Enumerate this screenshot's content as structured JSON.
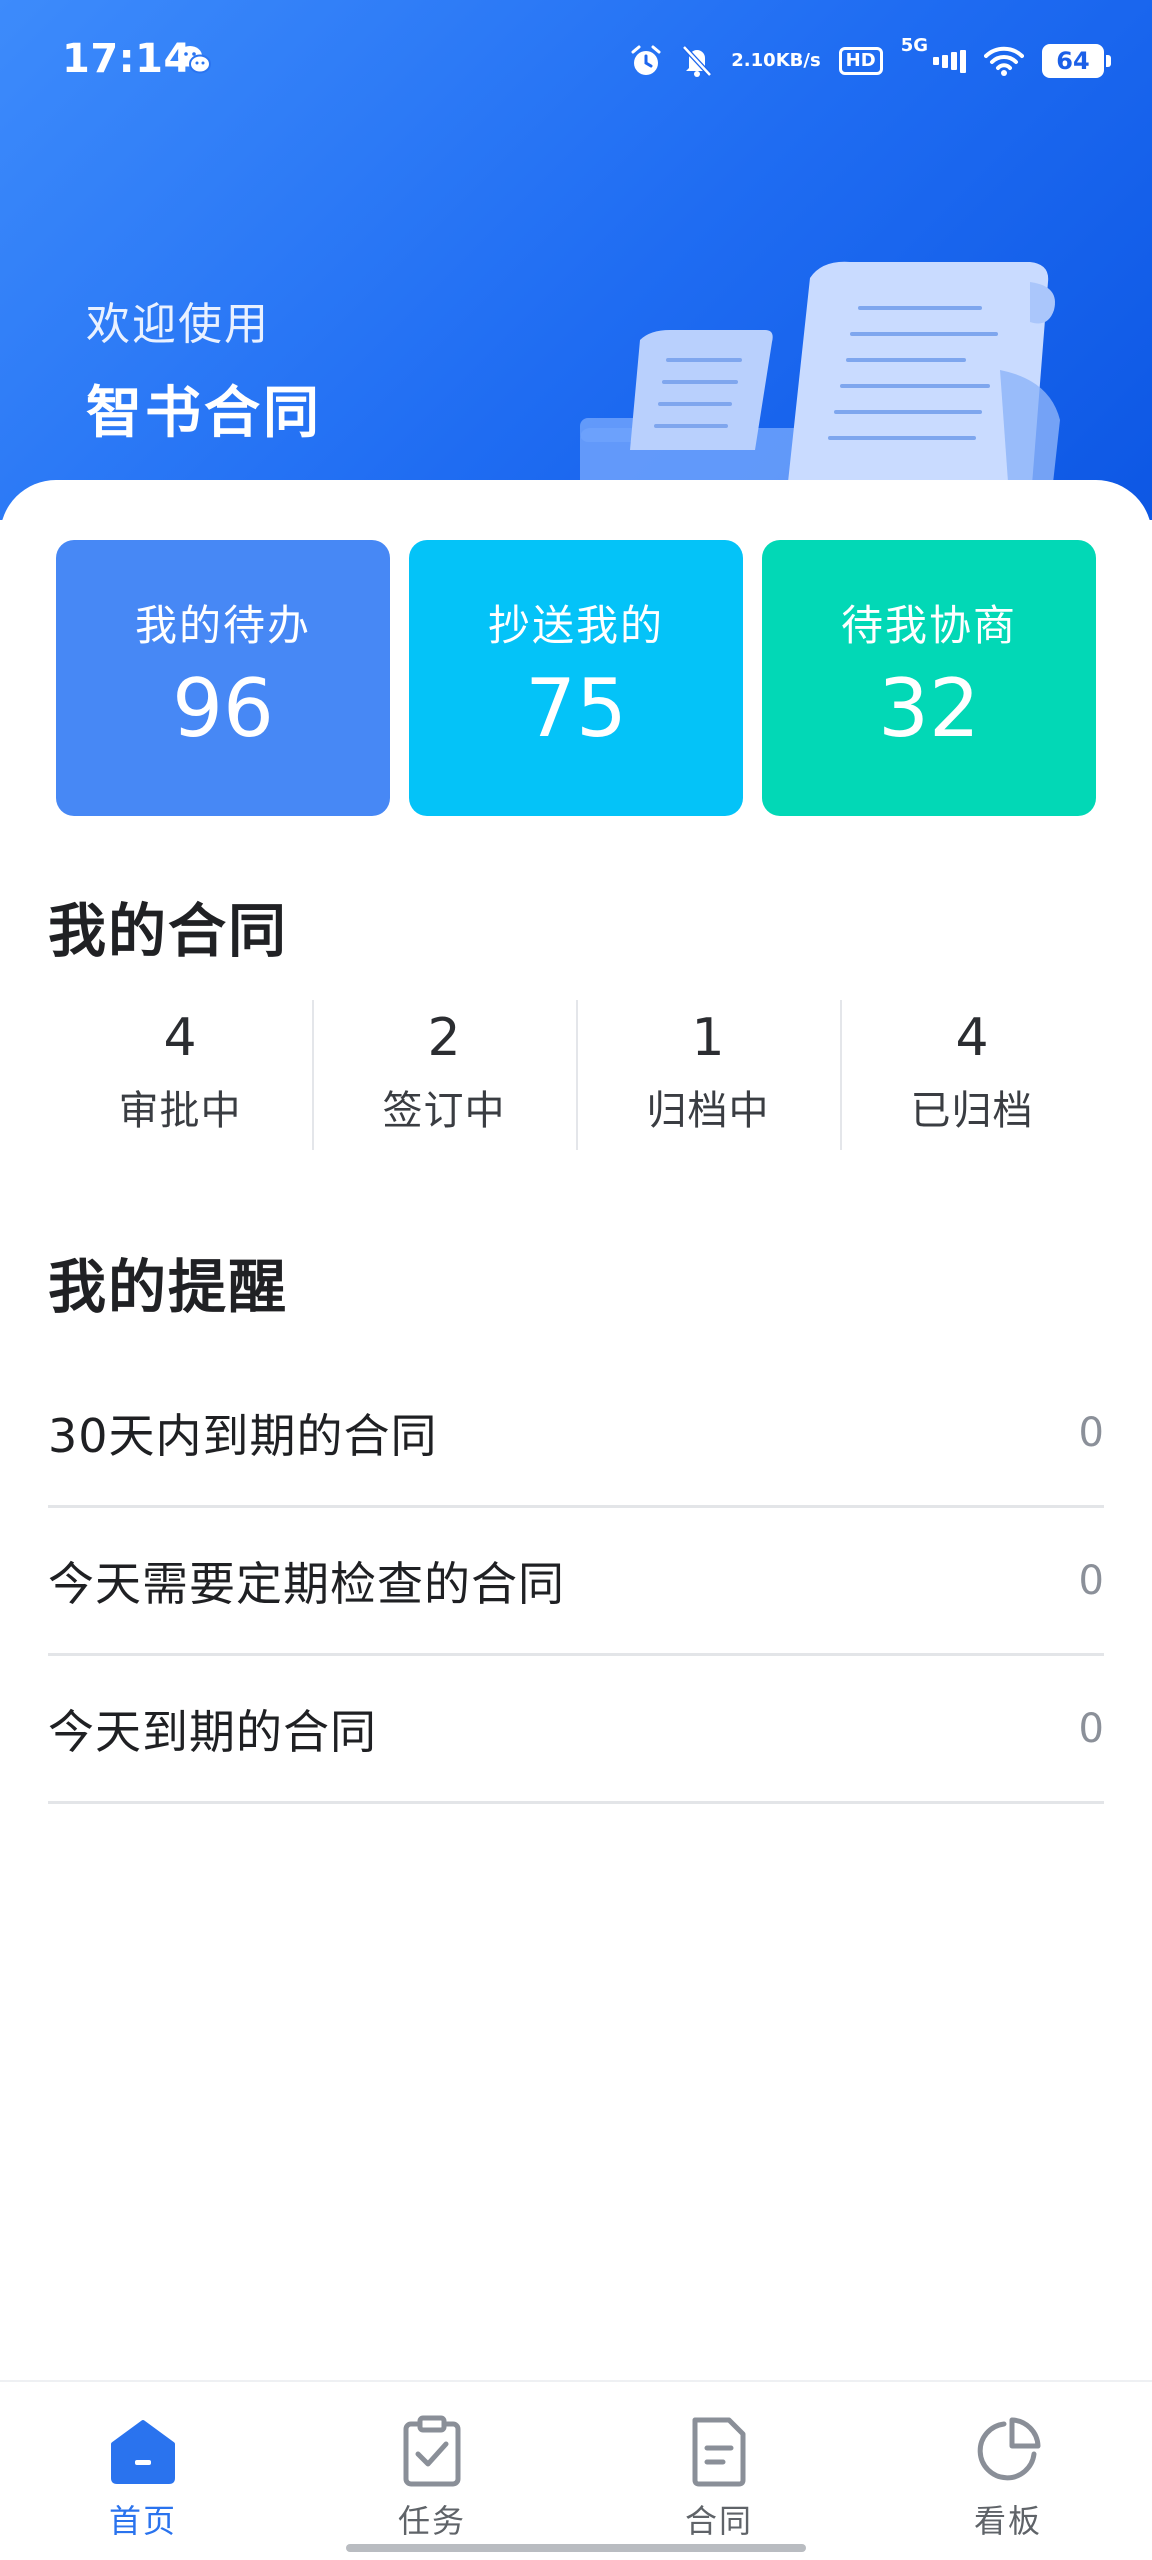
{
  "status_bar": {
    "time": "17:14",
    "net_speed_value": "2.10",
    "net_speed_unit": "KB/s",
    "hd_label": "HD",
    "network_label": "5G",
    "battery": "64",
    "icons": [
      "wechat-icon",
      "alarm-icon",
      "mute-bell-icon",
      "signal-icon",
      "wifi-icon",
      "battery-icon"
    ]
  },
  "header": {
    "welcome": "欢迎使用",
    "app_name": "智书合同"
  },
  "tiles": [
    {
      "label": "我的待办",
      "value": "96",
      "color": "#4788f5"
    },
    {
      "label": "抄送我的",
      "value": "75",
      "color": "#04c3f8"
    },
    {
      "label": "待我协商",
      "value": "32",
      "color": "#02d8b6"
    }
  ],
  "my_contracts": {
    "title": "我的合同",
    "stats": [
      {
        "value": "4",
        "label": "审批中"
      },
      {
        "value": "2",
        "label": "签订中"
      },
      {
        "value": "1",
        "label": "归档中"
      },
      {
        "value": "4",
        "label": "已归档"
      }
    ]
  },
  "my_reminders": {
    "title": "我的提醒",
    "items": [
      {
        "label": "30天内到期的合同",
        "count": "0"
      },
      {
        "label": "今天需要定期检查的合同",
        "count": "0"
      },
      {
        "label": "今天到期的合同",
        "count": "0"
      }
    ]
  },
  "bottom_nav": {
    "items": [
      {
        "label": "首页",
        "icon": "home-icon",
        "active": true
      },
      {
        "label": "任务",
        "icon": "clipboard-check-icon",
        "active": false
      },
      {
        "label": "合同",
        "icon": "document-icon",
        "active": false
      },
      {
        "label": "看板",
        "icon": "pie-chart-icon",
        "active": false
      }
    ],
    "active_color": "#2a73ee",
    "inactive_color": "#8a8f98"
  }
}
